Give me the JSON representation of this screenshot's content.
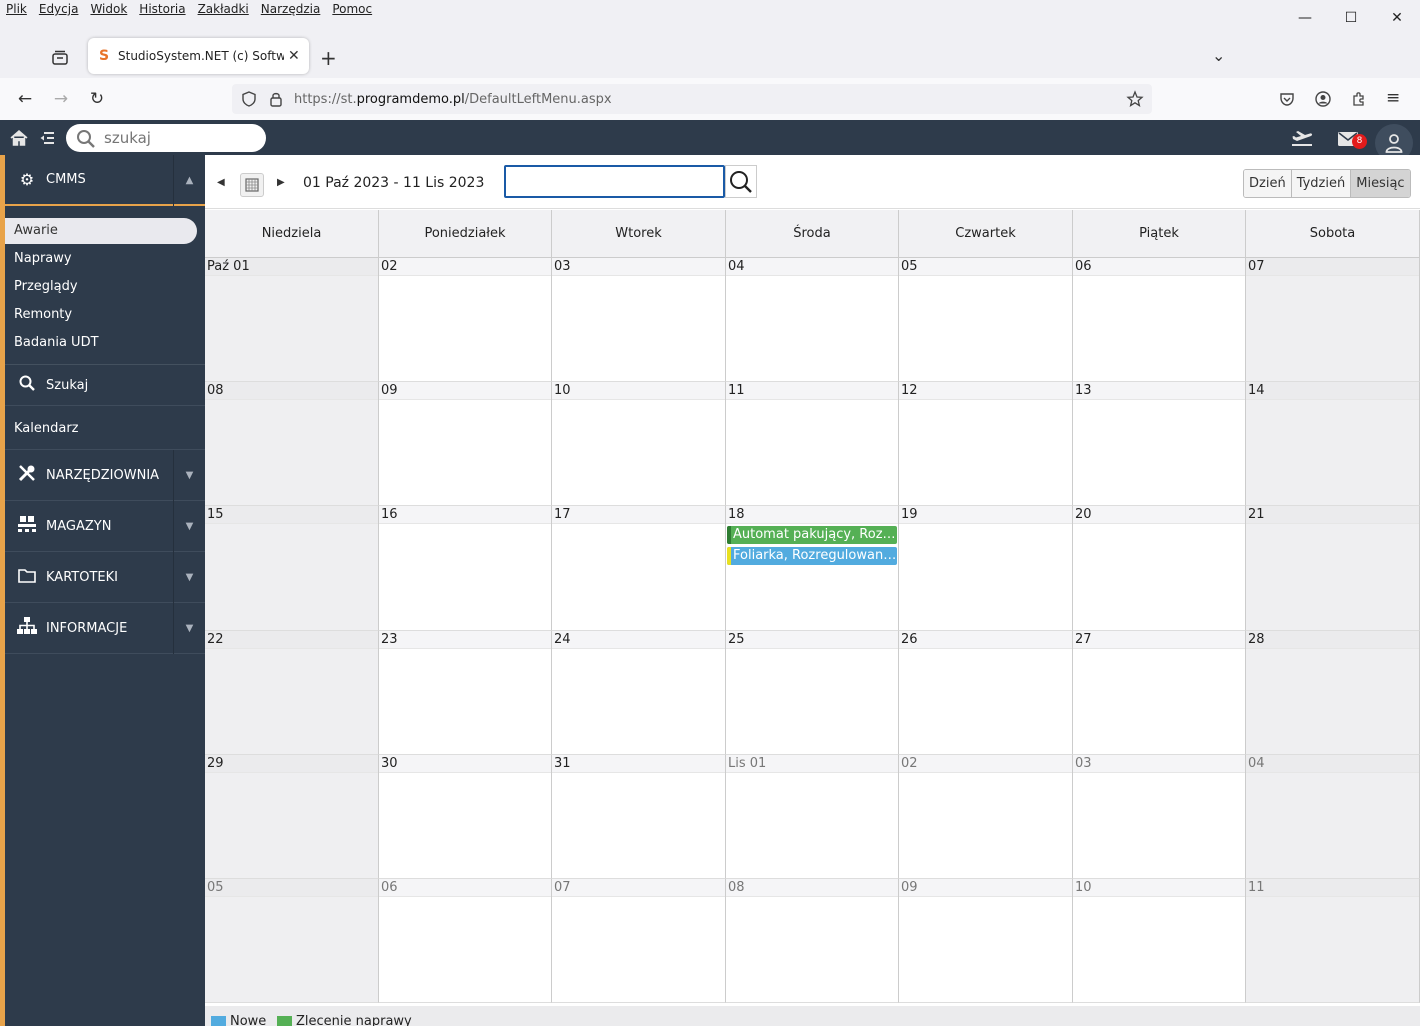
{
  "browser": {
    "menu": [
      "Plik",
      "Edycja",
      "Widok",
      "Historia",
      "Zakładki",
      "Narzędzia",
      "Pomoc"
    ],
    "tab_title": "StudioSystem.NET (c) Software S",
    "url_prefix": "https://st.",
    "url_domain": "programdemo.pl",
    "url_path": "/DefaultLeftMenu.aspx"
  },
  "app": {
    "search_placeholder": "szukaj",
    "mail_badge": "8"
  },
  "sidebar": {
    "cmms_label": "CMMS",
    "items": [
      "Awarie",
      "Naprawy",
      "Przeglądy",
      "Remonty",
      "Badania UDT"
    ],
    "search_label": "Szukaj",
    "calendar_label": "Kalendarz",
    "sections": [
      "NARZĘDZIOWNIA",
      "MAGAZYN",
      "KARTOTEKI",
      "INFORMACJE"
    ]
  },
  "calendar": {
    "range_label": "01 Paź 2023 - 11 Lis 2023",
    "views": [
      "Dzień",
      "Tydzień",
      "Miesiąc"
    ],
    "selected_view": "Miesiąc",
    "weekdays": [
      "Niedziela",
      "Poniedziałek",
      "Wtorek",
      "Środa",
      "Czwartek",
      "Piątek",
      "Sobota"
    ],
    "weeks": [
      [
        "Paź 01",
        "02",
        "03",
        "04",
        "05",
        "06",
        "07"
      ],
      [
        "08",
        "09",
        "10",
        "11",
        "12",
        "13",
        "14"
      ],
      [
        "15",
        "16",
        "17",
        "18",
        "19",
        "20",
        "21"
      ],
      [
        "22",
        "23",
        "24",
        "25",
        "26",
        "27",
        "28"
      ],
      [
        "29",
        "30",
        "31",
        "Lis 01",
        "02",
        "03",
        "04"
      ],
      [
        "05",
        "06",
        "07",
        "08",
        "09",
        "10",
        "11"
      ]
    ],
    "events": [
      {
        "week": 2,
        "day": 3,
        "title": "Automat pakujący, Roz…",
        "color": "#55b055",
        "stripe": "#2e7d32"
      },
      {
        "week": 2,
        "day": 3,
        "title": "Foliarka, Rozregulowan…",
        "color": "#52abdf",
        "stripe": "#e8e020"
      }
    ],
    "legend": [
      {
        "label": "Nowe",
        "color": "#52abdf"
      },
      {
        "label": "Zlecenie naprawy",
        "color": "#55b055"
      }
    ]
  }
}
